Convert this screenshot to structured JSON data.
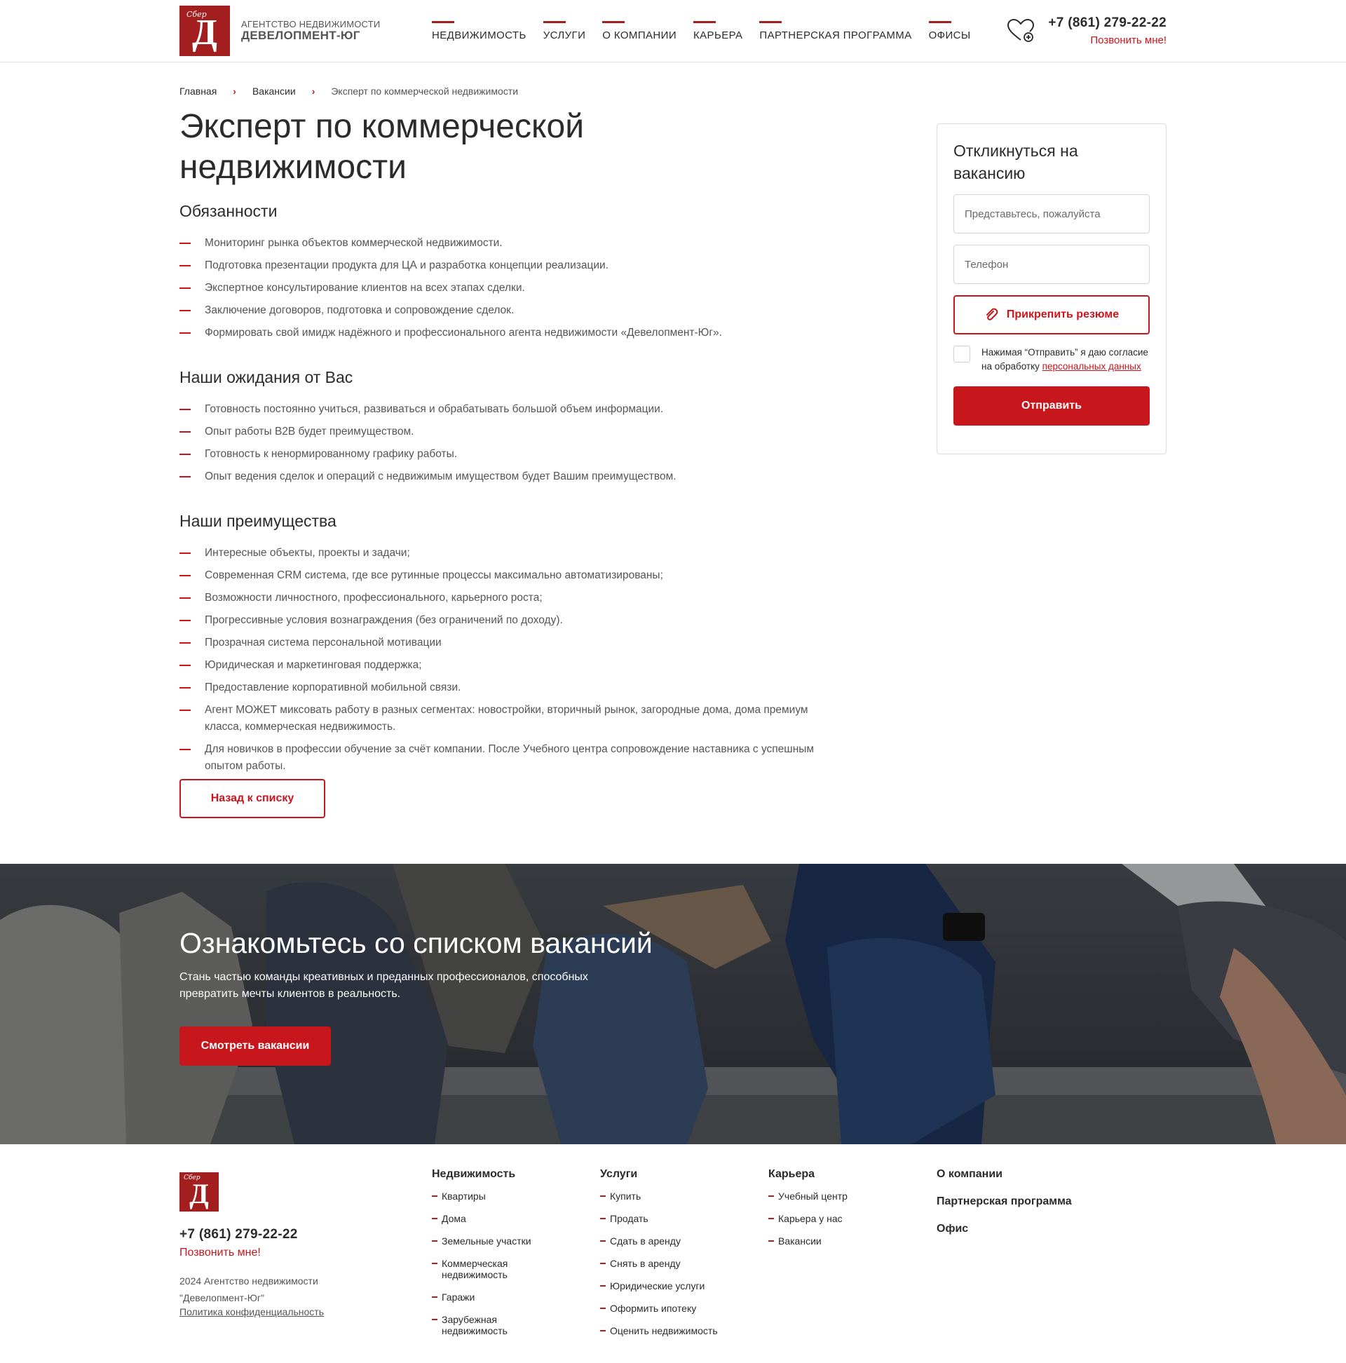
{
  "header": {
    "logo_line1": "АГЕНТСТВО НЕДВИЖИМОСТИ",
    "logo_line2": "ДЕВЕЛОПМЕНТ-ЮГ",
    "logo_mark": "Д",
    "logo_script": "Сбер",
    "nav": [
      {
        "label": "НЕДВИЖИМОСТЬ"
      },
      {
        "label": "УСЛУГИ"
      },
      {
        "label": "О КОМПАНИИ"
      },
      {
        "label": "КАРЬЕРА"
      },
      {
        "label": "ПАРТНЕРСКАЯ ПРОГРАММА"
      },
      {
        "label": "ОФИСЫ"
      }
    ],
    "favorites_icon": "heart-plus-icon",
    "phone": "+7 (861) 279-22-22",
    "callback": "Позвонить мне!"
  },
  "breadcrumb": [
    "Главная",
    "Вакансии",
    "Эксперт по коммерческой недвижимости"
  ],
  "title": "Эксперт по коммерческой недвижимости",
  "sections": {
    "duties": {
      "heading": "Обязанности",
      "items": [
        "Мониторинг рынка объектов коммерческой недвижимости.",
        "Подготовка презентации продукта для ЦА и разработка концепции реализации.",
        "Экспертное консультирование клиентов на всех этапах сделки.",
        "Заключение договоров, подготовка и сопровождение сделок.",
        "Формировать свой имидж надёжного и профессионального агента недвижимости «Девелопмент-Юг»."
      ]
    },
    "expectations": {
      "heading": "Наши ожидания от Вас",
      "items": [
        "Готовность постоянно учиться, развиваться и обрабатывать большой объем информации.",
        "Опыт работы B2B будет преимуществом.",
        "Готовность к ненормированному графику работы.",
        "Опыт ведения сделок и операций с недвижимым имуществом будет Вашим преимуществом."
      ]
    },
    "advantages": {
      "heading": "Наши преимущества",
      "items": [
        "Интересные объекты, проекты и задачи;",
        "Современная CRM система, где все рутинные процессы максимально автоматизированы;",
        "Возможности личностного, профессионального, карьерного роста;",
        "Прогрессивные условия вознаграждения (без ограничений по доходу).",
        "Прозрачная система персональной мотивации",
        "Юридическая и маркетинговая поддержка;",
        "Предоставление корпоративной мобильной связи.",
        "Агент МОЖЕТ миксовать работу в разных сегментах: новостройки, вторичный рынок, загородные дома, дома премиум класса, коммерческая недвижимость.",
        "Для новичков в профессии обучение за счёт компании. После Учебного центра сопровождение наставника с успешным опытом работы."
      ]
    }
  },
  "back_button": "Назад к списку",
  "form": {
    "title": "Откликнуться на вакансию",
    "name_placeholder": "Представьтесь, пожалуйста",
    "phone_placeholder": "Телефон",
    "attach_label": "Прикрепить резюме",
    "attach_icon": "paperclip-icon",
    "consent_text": "Нажимая “Отправить” я даю согласие на обработку",
    "consent_link": "персональных данных",
    "submit_label": "Отправить"
  },
  "banner": {
    "title": "Ознакомьтесь со списком вакансий",
    "subtitle": "Стань частью команды креативных и преданных профессионалов, способных превратить мечты клиентов в реальность.",
    "button": "Смотреть вакансии"
  },
  "footer": {
    "phone": "+7 (861) 279-22-22",
    "callback": "Позвонить мне!",
    "copyright": "2024 Агентство недвижимости \"Девелопмент-Юг\"",
    "policy": "Политика конфиденциальность",
    "columns": [
      {
        "heading": "Недвижимость",
        "items": [
          "Квартиры",
          "Дома",
          "Земельные участки",
          "Коммерческая недвижимость",
          "Гаражи",
          "Зарубежная недвижимость"
        ]
      },
      {
        "heading": "Услуги",
        "items": [
          "Купить",
          "Продать",
          "Сдать в аренду",
          "Снять в аренду",
          "Юридические услуги",
          "Оформить ипотеку",
          "Оценить недвижимость"
        ]
      },
      {
        "heading": "Карьера",
        "items": [
          "Учебный центр",
          "Карьера у нас",
          "Вакансии"
        ]
      }
    ],
    "links": [
      "О компании",
      "Партнерская программа",
      "Офис"
    ]
  },
  "colors": {
    "accent": "#c8161d",
    "logo_bg": "#a31f1f",
    "text": "#2b2b2b",
    "muted": "#555555"
  }
}
